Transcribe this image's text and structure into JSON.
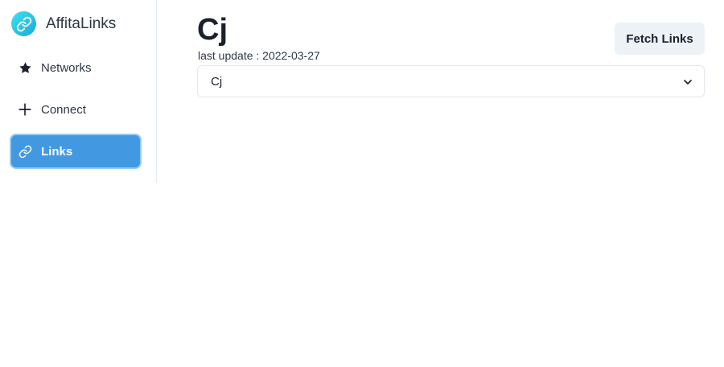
{
  "brand": {
    "name": "AffitaLinks",
    "logo_icon": "link-icon",
    "logo_color": "#1aa9d9"
  },
  "sidebar": {
    "items": [
      {
        "label": "Networks",
        "icon": "star-icon",
        "active": false
      },
      {
        "label": "Connect",
        "icon": "plus-icon",
        "active": false
      },
      {
        "label": "Links",
        "icon": "link-icon",
        "active": true
      }
    ],
    "active_color": "#4299e1"
  },
  "main": {
    "title": "Cj",
    "last_update": "last update : 2022-03-27",
    "fetch_button": "Fetch Links",
    "network_select": {
      "value": "Cj",
      "icon": "chevron-down-icon"
    }
  }
}
